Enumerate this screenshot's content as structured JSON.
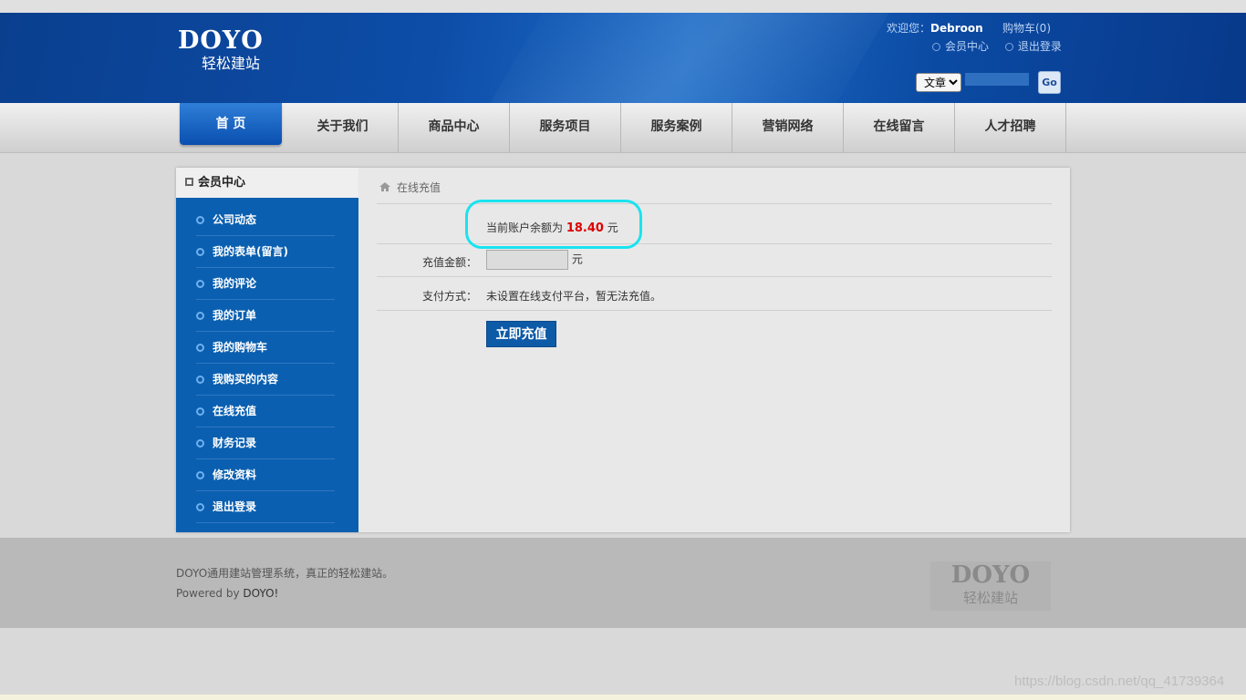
{
  "header": {
    "logo_brand": "DOYO",
    "logo_sub": "轻松建站",
    "welcome_prefix": "欢迎您：",
    "username": "Debroon",
    "cart": "购物车(0)",
    "member_center": "会员中心",
    "logout": "退出登录",
    "search_type": "文章",
    "go_label": "Go"
  },
  "nav": {
    "items": [
      "首 页",
      "关于我们",
      "商品中心",
      "服务项目",
      "服务案例",
      "营销网络",
      "在线留言",
      "人才招聘"
    ]
  },
  "sidebar": {
    "title": "会员中心",
    "items": [
      "公司动态",
      "我的表单(留言)",
      "我的评论",
      "我的订单",
      "我的购物车",
      "我购买的内容",
      "在线充值",
      "财务记录",
      "修改资料",
      "退出登录"
    ]
  },
  "content": {
    "breadcrumb": "在线充值",
    "balance_prefix": "当前账户余额为",
    "balance_amount": "18.40",
    "balance_unit": "元",
    "amount_label": "充值金额：",
    "amount_value": "",
    "amount_unit": "元",
    "payment_label": "支付方式：",
    "payment_text": "未设置在线支付平台，暂无法充值。",
    "submit_label": "立即充值"
  },
  "footer": {
    "line1": "DOYO通用建站管理系统，真正的轻松建站。",
    "powered_prefix": "Powered by",
    "powered_brand": "DOYO!",
    "logo_brand": "DOYO",
    "logo_sub": "轻松建站"
  },
  "watermark": "https://blog.csdn.net/qq_41739364",
  "colors": {
    "brand_blue": "#0a5fb0",
    "highlight_cyan": "#19e3f0",
    "amount_red": "#dd0000"
  }
}
